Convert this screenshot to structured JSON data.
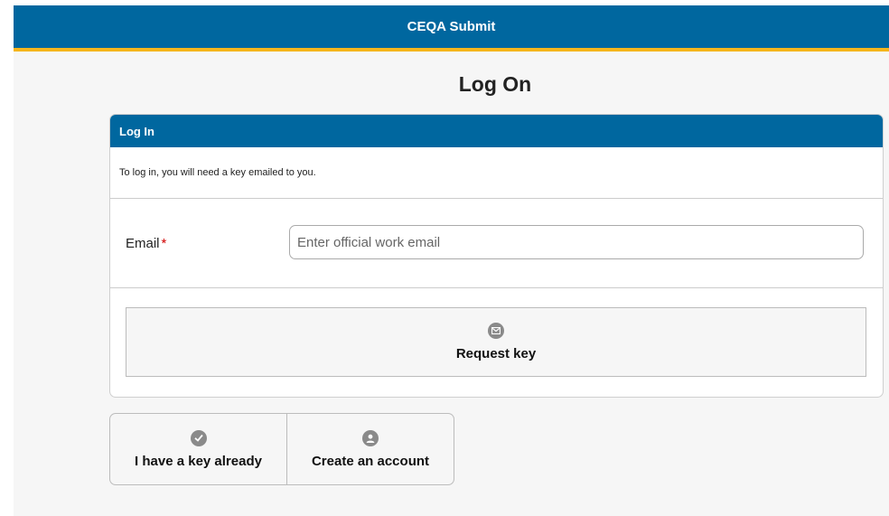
{
  "header": {
    "title": "CEQA Submit"
  },
  "page": {
    "title": "Log On"
  },
  "login_card": {
    "heading": "Log In",
    "intro": "To log in, you will need a key emailed to you.",
    "email_label": "Email",
    "required_marker": "*",
    "email_placeholder": "Enter official work email",
    "email_value": "",
    "request_button": {
      "label": "Request key",
      "icon": "envelope-icon"
    }
  },
  "secondary_actions": [
    {
      "label": "I have a key already",
      "icon": "check-circle-icon"
    },
    {
      "label": "Create an account",
      "icon": "user-icon"
    }
  ],
  "colors": {
    "header_blue": "#00679f",
    "accent_gold": "#f5b51c",
    "required_red": "#d10000",
    "icon_gray": "#8a8a8a"
  }
}
